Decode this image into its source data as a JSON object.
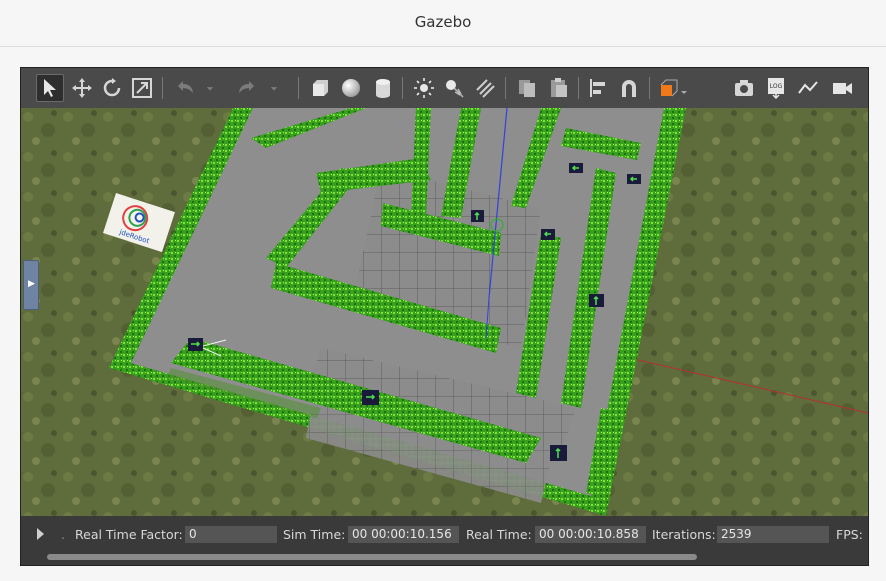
{
  "window": {
    "title": "Gazebo"
  },
  "toolbar": {
    "buttons": [
      {
        "name": "select-mode-icon",
        "label": "Select"
      },
      {
        "name": "translate-mode-icon",
        "label": "Translate"
      },
      {
        "name": "rotate-mode-icon",
        "label": "Rotate"
      },
      {
        "name": "scale-mode-icon",
        "label": "Scale"
      },
      {
        "name": "undo-icon",
        "label": "Undo"
      },
      {
        "name": "redo-icon",
        "label": "Redo"
      },
      {
        "name": "box-shape-icon",
        "label": "Box"
      },
      {
        "name": "sphere-shape-icon",
        "label": "Sphere"
      },
      {
        "name": "cylinder-shape-icon",
        "label": "Cylinder"
      },
      {
        "name": "point-light-icon",
        "label": "Point light"
      },
      {
        "name": "spot-light-icon",
        "label": "Spot light"
      },
      {
        "name": "directional-light-icon",
        "label": "Directional light"
      },
      {
        "name": "copy-icon",
        "label": "Copy"
      },
      {
        "name": "paste-icon",
        "label": "Paste"
      },
      {
        "name": "align-icon",
        "label": "Align"
      },
      {
        "name": "snap-icon",
        "label": "Snap"
      },
      {
        "name": "view-angle-icon",
        "label": "View angle"
      },
      {
        "name": "screenshot-icon",
        "label": "Screenshot"
      },
      {
        "name": "log-icon",
        "label": "Log"
      },
      {
        "name": "plot-icon",
        "label": "Plot"
      },
      {
        "name": "record-video-icon",
        "label": "Record video"
      }
    ],
    "log_text": "LOG"
  },
  "scene": {
    "logo_text": "jdeRobot",
    "colors": {
      "hedge": "#3fae1f",
      "floor": "#8e8e8e",
      "grass": "#5d6a3a",
      "marker": "#1a1a3a",
      "arrow": "#4fe04f"
    }
  },
  "statusbar": {
    "real_time_factor_label": "Real Time Factor:",
    "real_time_factor_value": "0",
    "sim_time_label": "Sim Time:",
    "sim_time_value": "00 00:00:10.156",
    "real_time_label": "Real Time:",
    "real_time_value": "00 00:00:10.858",
    "iterations_label": "Iterations:",
    "iterations_value": "2539",
    "fps_label": "FPS:"
  }
}
